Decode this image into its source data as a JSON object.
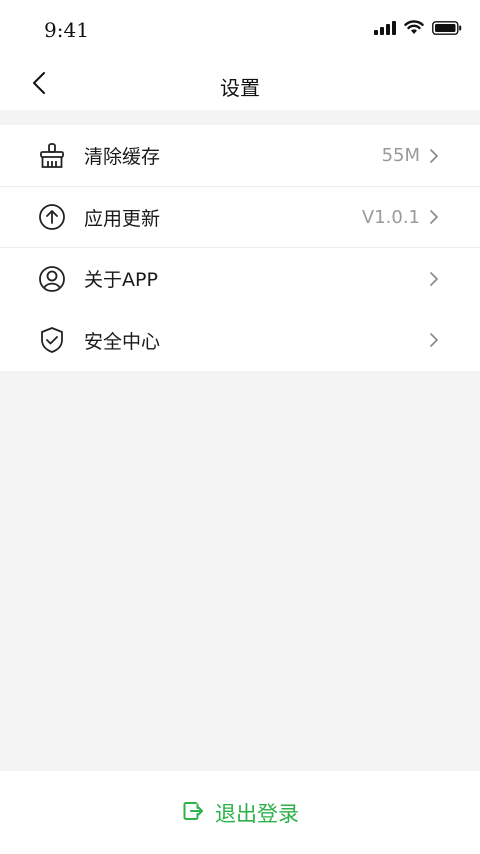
{
  "status_bar": {
    "time": "9:41",
    "icons": [
      "signal-icon",
      "wifi-icon",
      "battery-icon"
    ]
  },
  "nav": {
    "title": "设置",
    "back_icon": "chevron-left-icon"
  },
  "settings": {
    "items": [
      {
        "icon": "broom-icon",
        "label": "清除缓存",
        "value": "55M"
      },
      {
        "icon": "arrow-up-circle-icon",
        "label": "应用更新",
        "value": "V1.0.1"
      },
      {
        "icon": "user-circle-icon",
        "label": "关于APP",
        "value": ""
      },
      {
        "icon": "shield-check-icon",
        "label": "安全中心",
        "value": ""
      }
    ]
  },
  "logout": {
    "label": "退出登录",
    "icon": "logout-icon"
  },
  "colors": {
    "accent": "#2db24a",
    "background": "#f3f3f3",
    "value_text": "#9a9a9a"
  }
}
